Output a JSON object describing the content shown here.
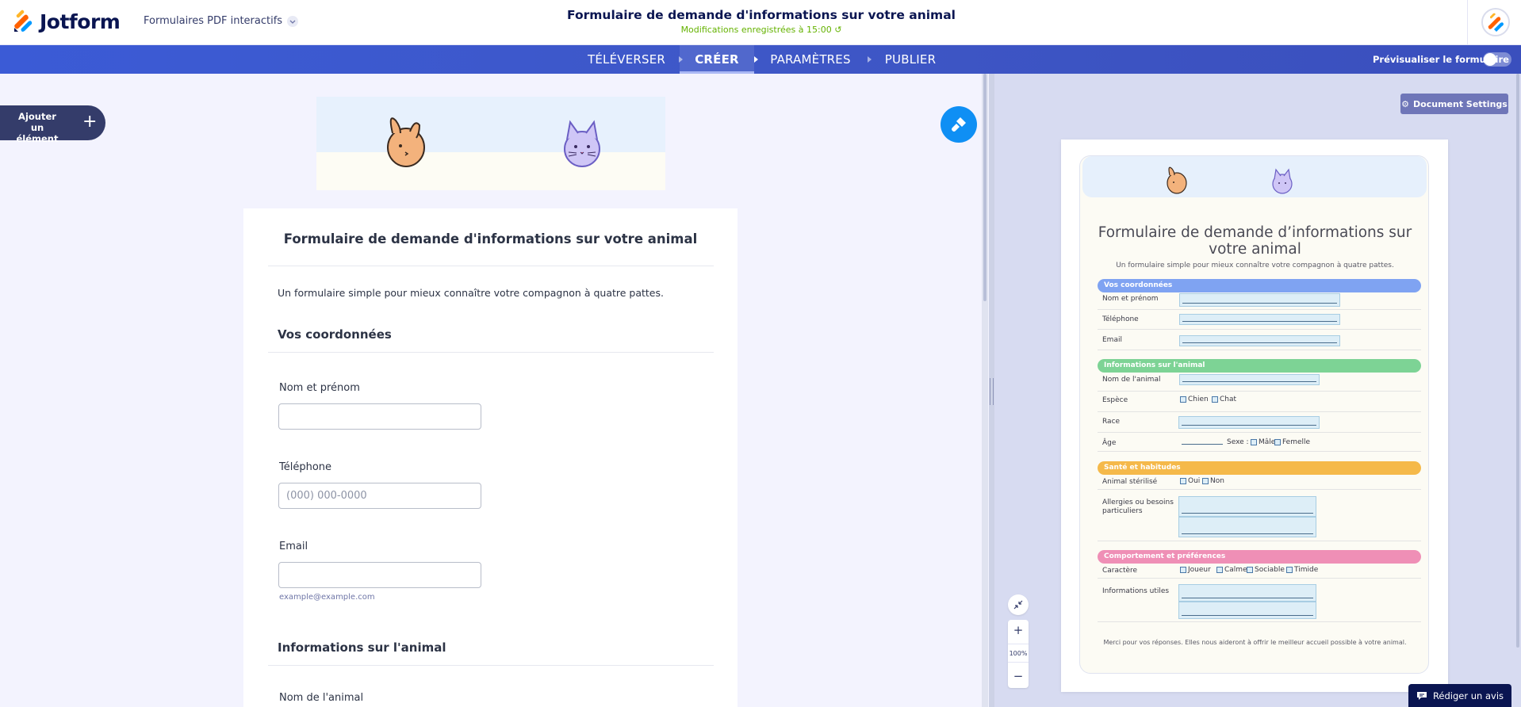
{
  "app": {
    "brand": "Jotform",
    "product": "Formulaires PDF interactifs",
    "doc_title": "Formulaire de demande d'informations sur votre animal",
    "save_status": "Modifications enregistrées à 15:00"
  },
  "nav": {
    "items": [
      {
        "label": "TÉLÉVERSER",
        "active": false
      },
      {
        "label": "CRÉER",
        "active": true
      },
      {
        "label": "PARAMÈTRES",
        "active": false
      },
      {
        "label": "PUBLIER",
        "active": false
      }
    ],
    "preview_label": "Prévisualiser le formulaire",
    "preview_on": false
  },
  "editor": {
    "add_element": "Ajouter un élément",
    "form_title": "Formulaire de demande d'informations sur votre animal",
    "form_subtitle": "Un formulaire simple pour mieux connaître votre compagnon à quatre pattes.",
    "section_contact": "Vos coordonnées",
    "fields": [
      {
        "label": "Nom et prénom",
        "placeholder": "",
        "hint": ""
      },
      {
        "label": "Téléphone",
        "placeholder": "(000) 000-0000",
        "hint": ""
      },
      {
        "label": "Email",
        "placeholder": "",
        "hint": "example@example.com"
      }
    ],
    "section_animal": "Informations sur l'animal",
    "field_animal_name": "Nom de l'animal"
  },
  "preview": {
    "doc_settings": "Document Settings",
    "title": "Formulaire de demande d’informations sur votre animal",
    "subtitle": "Un formulaire simple pour mieux connaître votre compagnon à quatre pattes.",
    "sections": [
      {
        "title": "Vos coordonnées",
        "color": "#7fa3f2"
      },
      {
        "title": "Informations sur l'animal",
        "color": "#7dd395"
      },
      {
        "title": "Santé et habitudes",
        "color": "#f5b94a"
      },
      {
        "title": "Comportement et préférences",
        "color": "#ef8fb6"
      }
    ],
    "labels": {
      "nom": "Nom et prénom",
      "tel": "Téléphone",
      "email": "Email",
      "animal": "Nom de l'animal",
      "espece": "Espèce",
      "race": "Race",
      "age": "Âge",
      "sexe": "Sexe :",
      "sterilise": "Animal stérilisé",
      "allergies": "Allergies ou besoins particuliers",
      "caractere": "Caractère",
      "infos": "Informations utiles"
    },
    "options": {
      "espece": [
        "Chien",
        "Chat"
      ],
      "sexe": [
        "Mâle",
        "Femelle"
      ],
      "sterilise": [
        "Oui",
        "Non"
      ],
      "caractere": [
        "Joueur",
        "Calme",
        "Sociable",
        "Timide"
      ]
    },
    "footer": "Merci pour vos réponses. Elles nous aideront à offrir le meilleur accueil possible à votre animal.",
    "zoom_level": "100%",
    "review": "Rédiger un avis"
  }
}
